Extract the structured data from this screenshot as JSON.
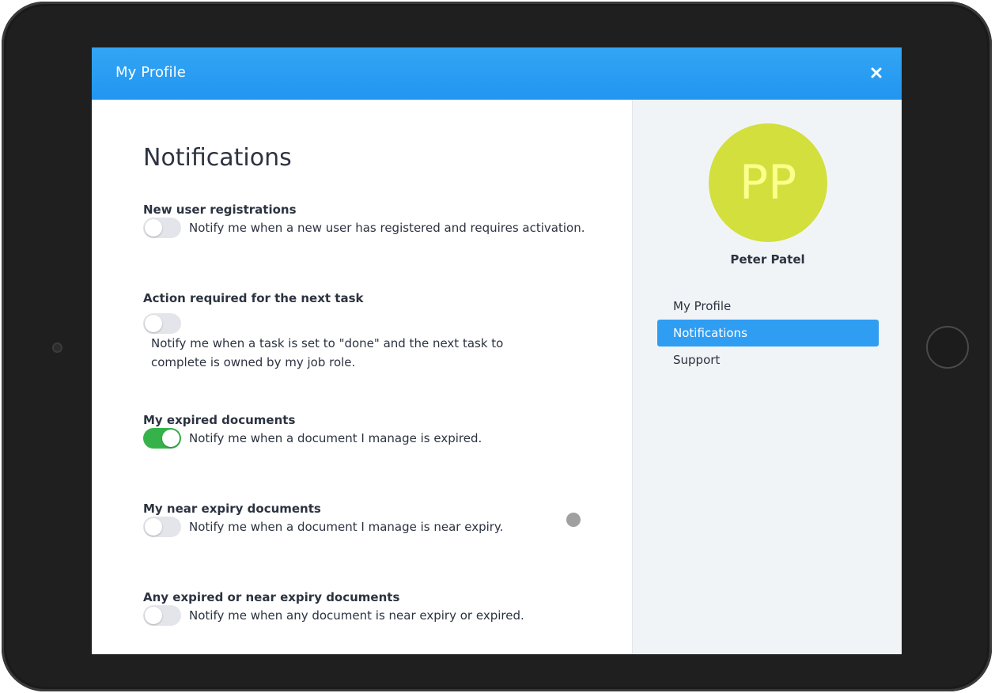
{
  "header": {
    "title": "My Profile",
    "close_icon": "close-icon"
  },
  "main": {
    "title": "Notifications",
    "settings": [
      {
        "title": "New user registrations",
        "description": "Notify me when a new user has registered and requires activation.",
        "enabled": false
      },
      {
        "title": "Action required for the next task",
        "description": "Notify me when a task is set to \"done\" and the next task to complete is owned by my job role.",
        "enabled": false
      },
      {
        "title": "My expired documents",
        "description": "Notify me when a document I manage is expired.",
        "enabled": true
      },
      {
        "title": "My near expiry documents",
        "description": "Notify me when a document I manage is near expiry.",
        "enabled": false
      },
      {
        "title": "Any expired or near expiry documents",
        "description": "Notify me when any document is near expiry or expired.",
        "enabled": false
      }
    ]
  },
  "sidebar": {
    "avatar_initials": "PP",
    "user_name": "Peter Patel",
    "nav": [
      {
        "label": "My Profile",
        "active": false
      },
      {
        "label": "Notifications",
        "active": true
      },
      {
        "label": "Support",
        "active": false
      }
    ]
  },
  "colors": {
    "header": "#2196f0",
    "accent": "#2f9df2",
    "toggle_on": "#35b34a",
    "toggle_off": "#e4e5ea",
    "avatar_bg": "#d2df3d",
    "avatar_text": "#fbff8c",
    "sidebar_bg": "#f1f4f7"
  }
}
